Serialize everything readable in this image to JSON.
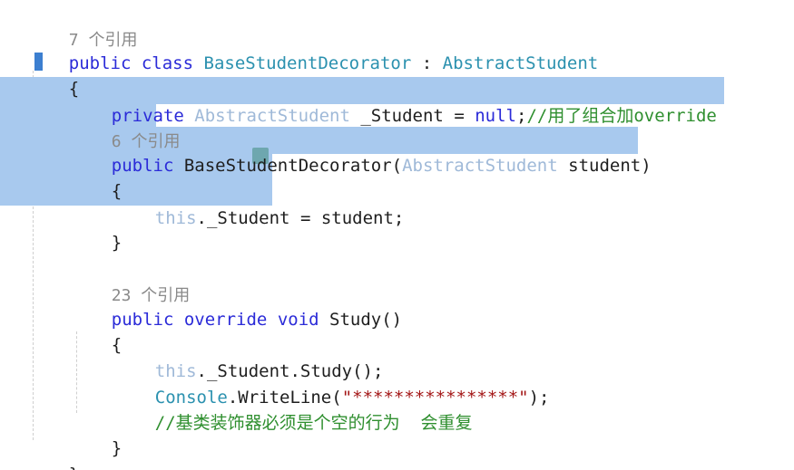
{
  "code": {
    "ref7": "7 个引用",
    "l_public": "public",
    "l_class": "class",
    "l_classname": "BaseStudentDecorator",
    "l_colon": ":",
    "l_base": "AbstractStudent",
    "brace_open": "{",
    "brace_close": "}",
    "l_private": "private",
    "field_type": "AbstractStudent",
    "field_name": "_Student",
    "eq": "=",
    "null_kw": "null",
    "semicolon": ";",
    "field_comment": "//用了组合加override",
    "ref6": "6 个引用",
    "ctor_name": "BaseStudentDecorator(",
    "param_type": "AbstractStudent",
    "param_name": "student)",
    "this_kw": "this",
    "assign_rest": "._Student",
    "assign_value": "= student;",
    "ref23": "23 个引用",
    "l_override": "override",
    "l_void": "void",
    "method_name": "Study()",
    "call_study": "._Student.Study();",
    "console": "Console",
    "writeline": ".WriteLine(",
    "str_value": "\"****************\"",
    "close_call": ");",
    "comment_line": "//基类装饰器必须是个空的行为  会重复"
  },
  "colors": {
    "keyword": "#2b2bd8",
    "type": "#2b91af",
    "comment": "#2f8f2f",
    "string": "#a31515",
    "selection": "#a8c9ee"
  }
}
